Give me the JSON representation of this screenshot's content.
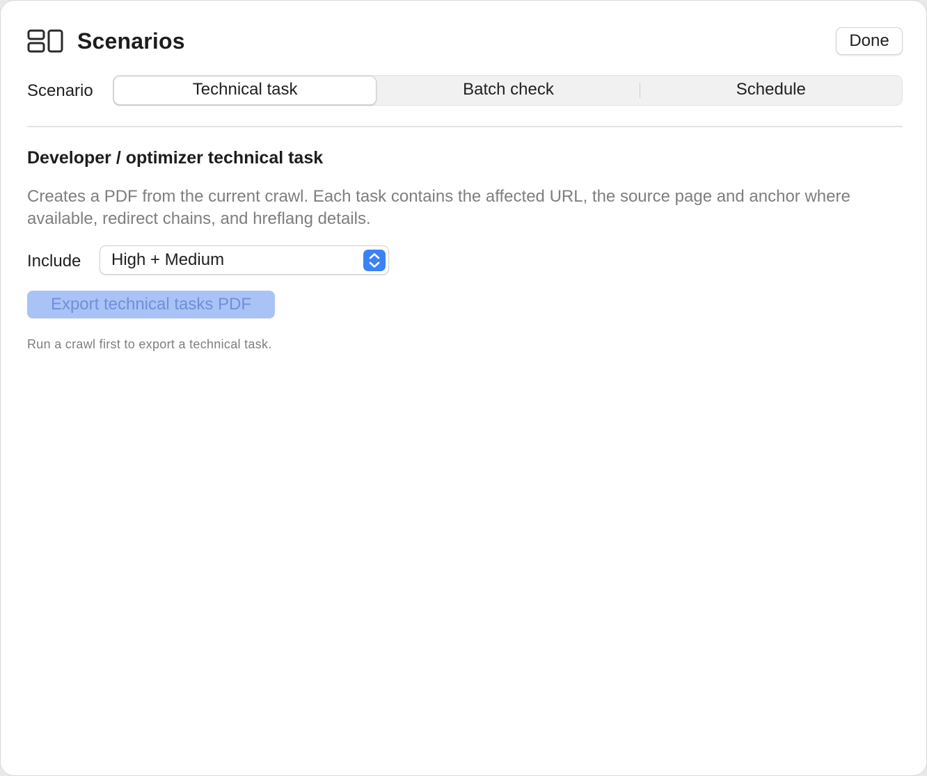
{
  "header": {
    "icon": "layout-icon",
    "title": "Scenarios",
    "done_label": "Done"
  },
  "scenario": {
    "label": "Scenario",
    "segments": [
      {
        "label": "Technical task",
        "selected": true
      },
      {
        "label": "Batch check",
        "selected": false
      },
      {
        "label": "Schedule",
        "selected": false
      }
    ]
  },
  "technical_task": {
    "heading": "Developer / optimizer technical task",
    "description": "Creates a PDF from the current crawl. Each task contains the affected URL, the source page and anchor where available, redirect chains, and hreflang details.",
    "include_label": "Include",
    "include_value": "High + Medium",
    "export_label": "Export technical tasks PDF",
    "export_enabled": false,
    "hint": "Run a crawl first to export a technical task."
  },
  "colors": {
    "accent": "#3b82f6",
    "disabled_button_bg": "#a9c3f7",
    "disabled_button_text": "#6f8fd8",
    "secondary_text": "#7e7e7e"
  }
}
